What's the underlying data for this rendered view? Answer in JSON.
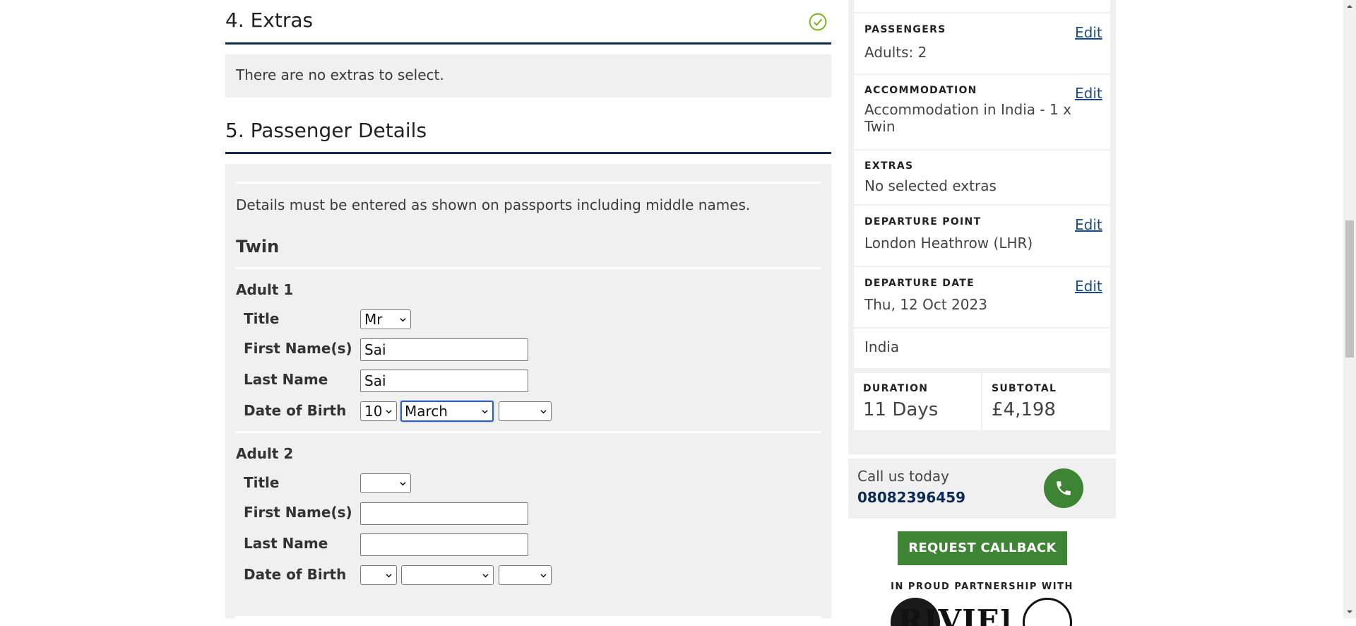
{
  "extras": {
    "heading": "4. Extras",
    "message": "There are no extras to select.",
    "complete_icon": "check-circle-icon",
    "accent_color": "#7ab41d"
  },
  "passenger_details": {
    "heading": "5. Passenger Details",
    "note": "Details must be entered as shown on passports including middle names.",
    "room": "Twin",
    "labels": {
      "title": "Title",
      "first_name": "First Name(s)",
      "last_name": "Last Name",
      "dob": "Date of Birth"
    },
    "adults": [
      {
        "heading": "Adult 1",
        "title": "Mr",
        "first_name": "Sai",
        "last_name": "Sai",
        "dob_day": "10",
        "dob_month": "March",
        "dob_year": ""
      },
      {
        "heading": "Adult 2",
        "title": "",
        "first_name": "",
        "last_name": "",
        "dob_day": "",
        "dob_month": "",
        "dob_year": ""
      }
    ]
  },
  "summary": {
    "edit_label": "Edit",
    "passengers": {
      "label": "PASSENGERS",
      "value": "Adults: 2"
    },
    "accommodation": {
      "label": "ACCOMMODATION",
      "value_line1": "Accommodation in India - 1 x",
      "value_line2": "Twin"
    },
    "extras": {
      "label": "EXTRAS",
      "value": "No selected extras"
    },
    "departure_point": {
      "label": "DEPARTURE POINT",
      "value": "London Heathrow (LHR)"
    },
    "departure_date": {
      "label": "DEPARTURE DATE",
      "value": "Thu, 12 Oct 2023"
    },
    "destination": "India",
    "duration": {
      "label": "DURATION",
      "value": "11 Days"
    },
    "subtotal": {
      "label": "SUBTOTAL",
      "value": "£4,198"
    }
  },
  "contact": {
    "call_text": "Call us today",
    "phone": "08082396459",
    "phone_icon": "phone-icon",
    "callback_button": "REQUEST CALLBACK",
    "partnership_text": "IN PROUD PARTNERSHIP WITH",
    "partner_logo_text": "RIVIERA",
    "green_color": "#3d8534",
    "navy_color": "#0e2a5a"
  }
}
